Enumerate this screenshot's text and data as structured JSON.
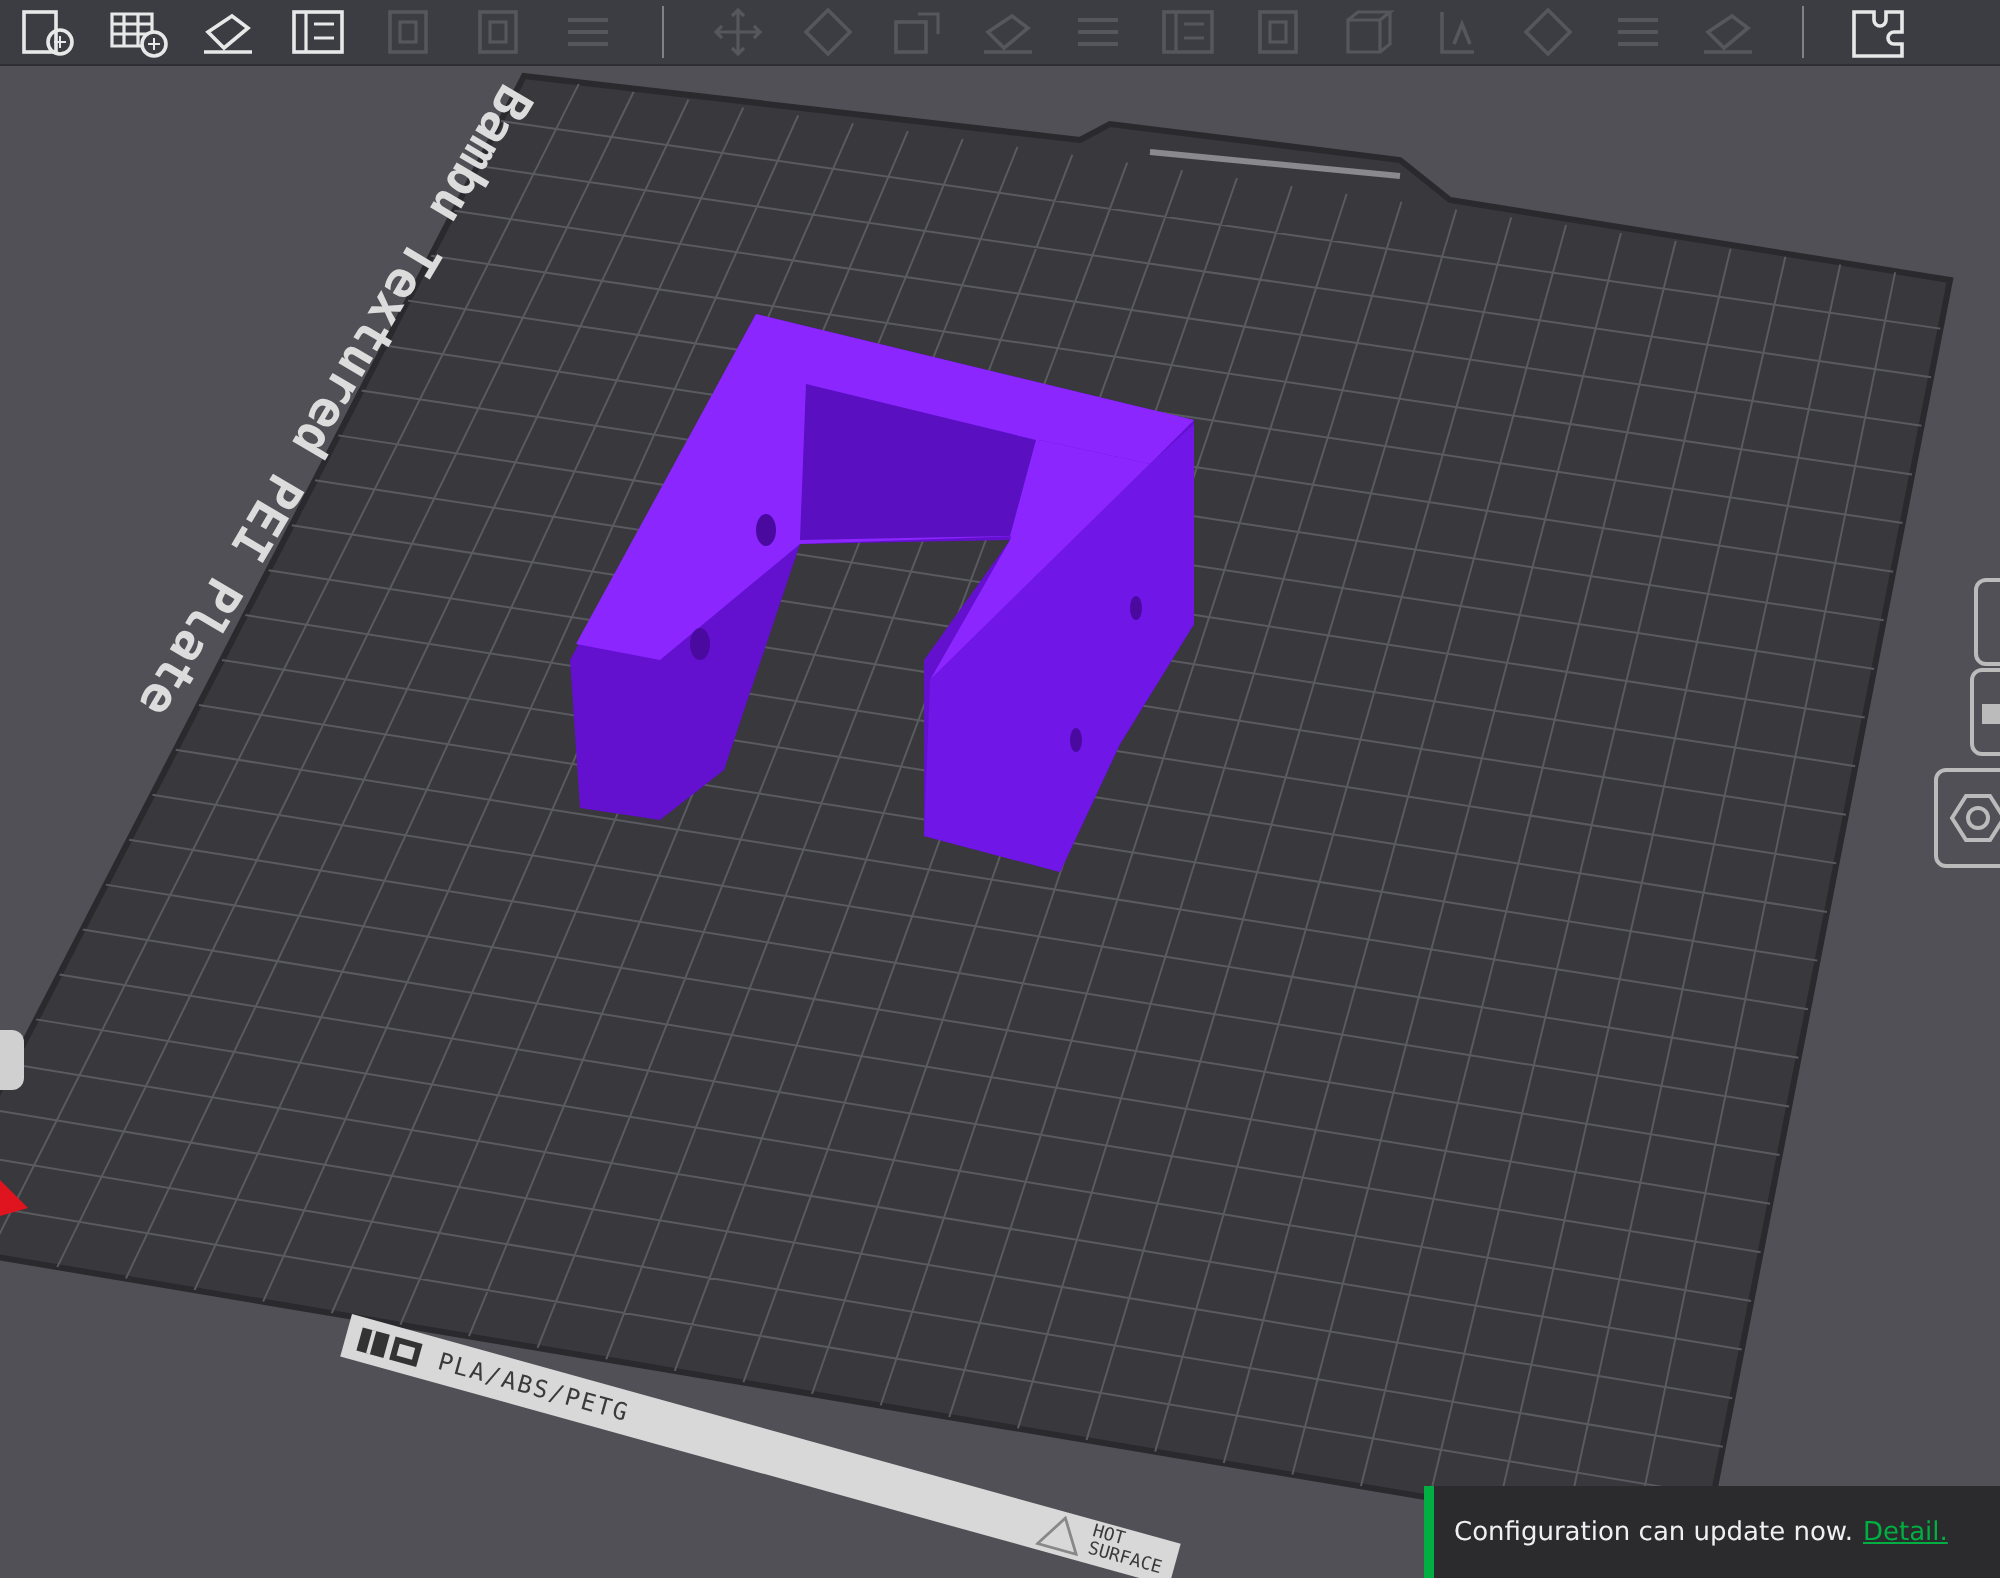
{
  "toolbar": {
    "buttons": [
      {
        "kind": "add",
        "disabled": false
      },
      {
        "kind": "grid",
        "disabled": false
      },
      {
        "kind": "orient",
        "disabled": false
      },
      {
        "kind": "layout",
        "disabled": false
      },
      {
        "kind": "box",
        "disabled": true
      },
      {
        "kind": "box",
        "disabled": true
      },
      {
        "kind": "lines",
        "disabled": true
      },
      {
        "kind": "separator"
      },
      {
        "kind": "move",
        "disabled": true
      },
      {
        "kind": "rotate",
        "disabled": true
      },
      {
        "kind": "scale",
        "disabled": true
      },
      {
        "kind": "orient",
        "disabled": true
      },
      {
        "kind": "lines",
        "disabled": true
      },
      {
        "kind": "layout",
        "disabled": true
      },
      {
        "kind": "box",
        "disabled": true
      },
      {
        "kind": "cube",
        "disabled": true
      },
      {
        "kind": "text",
        "disabled": true
      },
      {
        "kind": "rotate",
        "disabled": true
      },
      {
        "kind": "lines",
        "disabled": true
      },
      {
        "kind": "orient",
        "disabled": true
      },
      {
        "kind": "separator"
      },
      {
        "kind": "puzzle",
        "disabled": false
      }
    ]
  },
  "plate": {
    "label": "Bambu Textured PEI Plate",
    "material": "PLA/ABS/PETG",
    "warning": [
      "HOT",
      "SURFACE"
    ]
  },
  "notification": {
    "text": "Configuration can update now.",
    "link": "Detail."
  }
}
